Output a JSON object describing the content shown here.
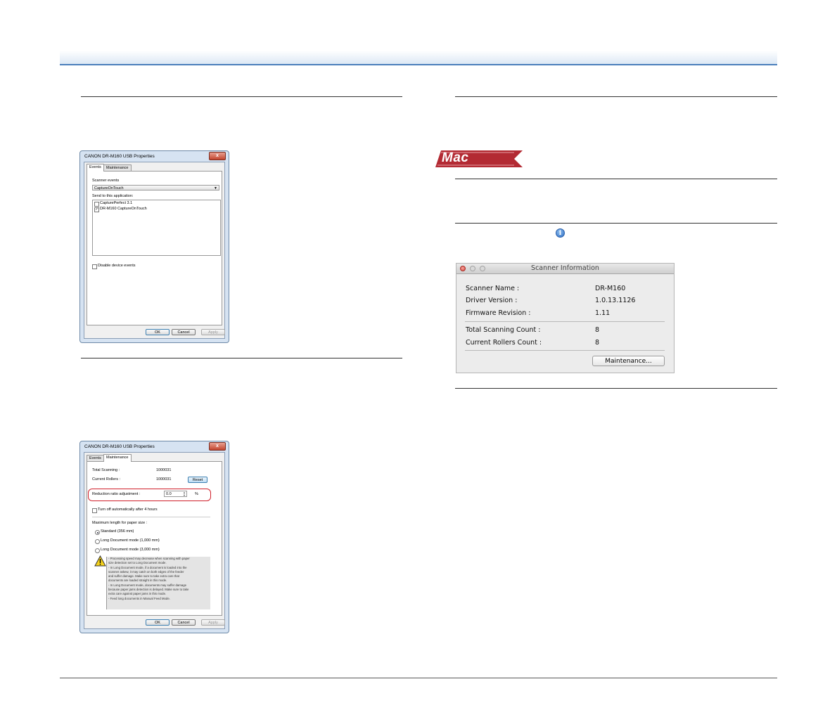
{
  "dialog_events": {
    "title": "CANON DR-M160 USB Properties",
    "close_glyph": "x",
    "tabs": [
      "Events",
      "Maintenance"
    ],
    "scanner_events_label": "Scanner events",
    "scanner_events_value": "CaptureOnTouch",
    "send_to_label": "Send to this application:",
    "apps": [
      {
        "label": "CapturePerfect 3.1",
        "checked": false
      },
      {
        "label": "DR-M160 CaptureOnTouch",
        "checked": true
      }
    ],
    "disable_label": "Disable device events",
    "ok": "OK",
    "cancel": "Cancel",
    "apply": "Apply"
  },
  "dialog_maintenance": {
    "title": "CANON DR-M160 USB Properties",
    "close_glyph": "x",
    "tabs": [
      "Events",
      "Maintenance"
    ],
    "total_scanning_label": "Total Scanning :",
    "total_scanning_value": "1000031",
    "current_rollers_label": "Current Rollers :",
    "current_rollers_value": "1000031",
    "reset": "Reset",
    "reduction_label": "Reduction ratio adjustment :",
    "reduction_value": "0.0",
    "reduction_unit": "%",
    "turn_off_label": "Turn off automatically after 4 hours",
    "max_length_label": "Maximum length for paper size :",
    "options": [
      {
        "label": "Standard (356 mm)",
        "selected": true
      },
      {
        "label": "Long Document mode (1,000 mm)",
        "selected": false
      },
      {
        "label": "Long Document mode (3,000 mm)",
        "selected": false
      }
    ],
    "warning_lines": [
      "- Processing speed may decrease when scanning with paper",
      "size detection set to Long Document mode.",
      "- In Long Document mode, if a document is loaded into the",
      "scanner askew, it may catch on both edges of the feeder",
      "and suffer damage. Make sure to take extra care that",
      "documents are loaded straight in this mode.",
      "- In Long Document mode, documents may suffer damage",
      "because paper jams detection is delayed. Make sure to take",
      "extra care against paper jams in this mode.",
      "- Feed long documents in Manual Feed Mode."
    ],
    "ok": "OK",
    "cancel": "Cancel",
    "apply": "Apply"
  },
  "mac_badge": "Mac",
  "scanner_info": {
    "title": "Scanner Information",
    "rows": [
      {
        "label": "Scanner Name :",
        "value": "DR-M160"
      },
      {
        "label": "Driver Version :",
        "value": "1.0.13.1126"
      },
      {
        "label": "Firmware Revision :",
        "value": "1.11"
      },
      {
        "label": "Total Scanning Count :",
        "value": "8"
      },
      {
        "label": "Current Rollers Count :",
        "value": "8"
      }
    ],
    "maintenance_button": "Maintenance..."
  },
  "info_icon_glyph": "i",
  "colors": {
    "accent_line": "#4a7ebb",
    "mac_badge": "#b32a33",
    "highlight": "#d0202a"
  }
}
